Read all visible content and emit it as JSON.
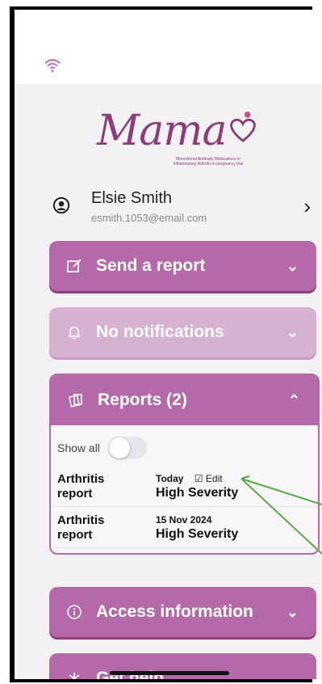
{
  "app": {
    "logo_text": "Mama",
    "logo_subtitle": "Monoclonal Antibody Medications in Inflammatory Arthritis in pregnancy trial",
    "brand_color": "#b46aa8",
    "pale_color": "#d7b2d0"
  },
  "user": {
    "name": "Elsie Smith",
    "email": "esmith.1053@email.com"
  },
  "menu": {
    "send_report": "Send a report",
    "notifications": "No notifications",
    "reports": "Reports (2)",
    "access_info": "Access information",
    "get_help": "Get help"
  },
  "reports": {
    "show_all_label": "Show all",
    "show_all_on": false,
    "edit_label": "Edit",
    "items": [
      {
        "name_line1": "Arthritis",
        "name_line2": "report",
        "date": "Today",
        "severity": "High Severity"
      },
      {
        "name_line1": "Arthritis",
        "name_line2": "report",
        "date": "15 Nov 2024",
        "severity": "High Severity"
      }
    ]
  }
}
